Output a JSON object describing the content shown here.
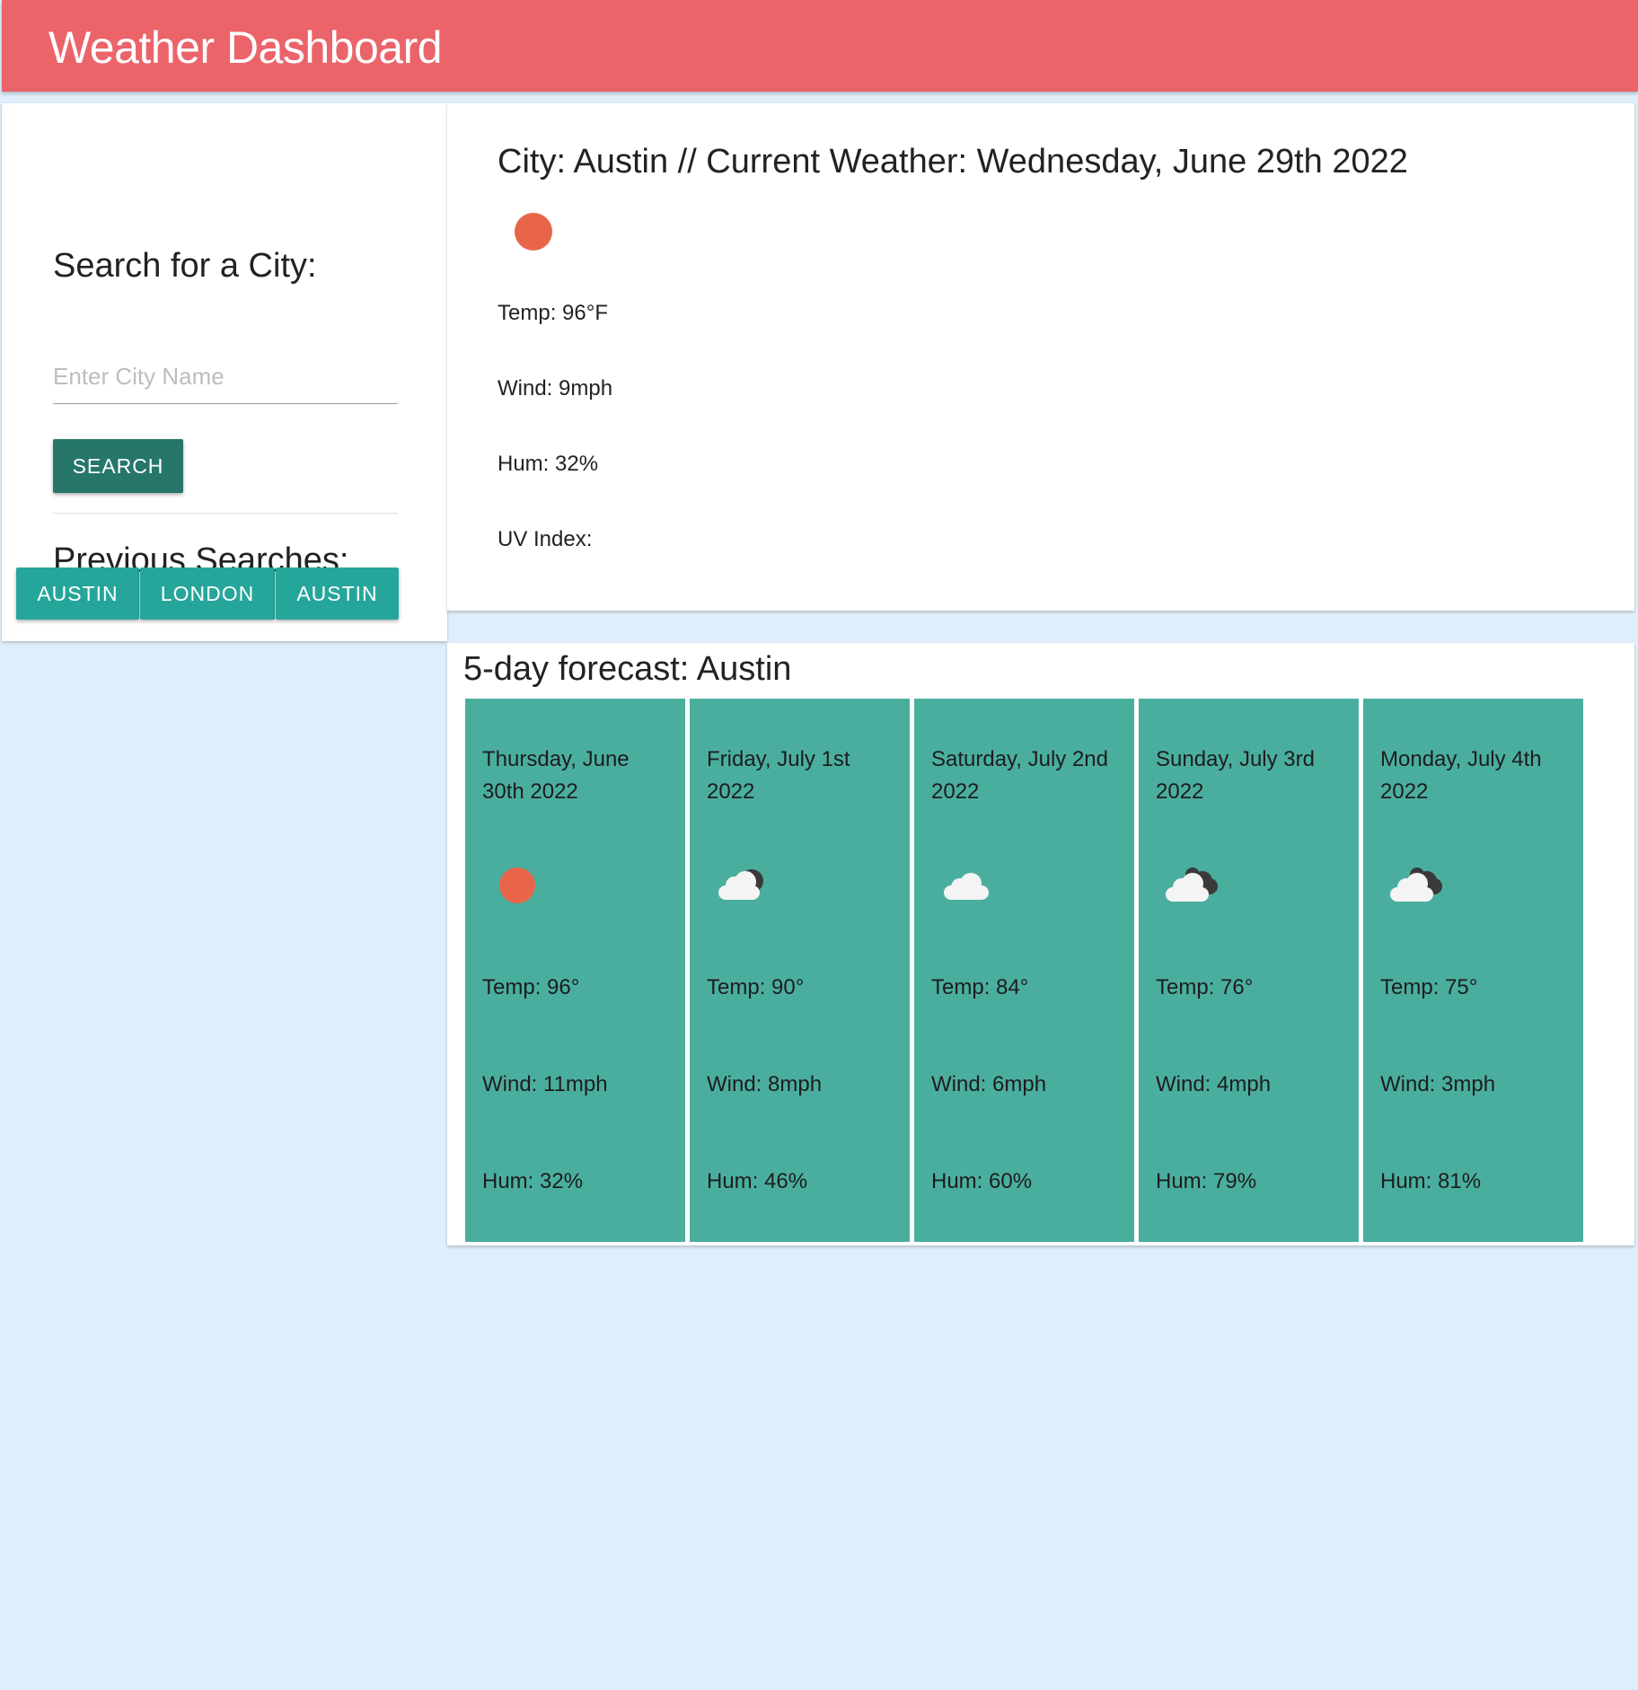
{
  "header": {
    "title": "Weather Dashboard"
  },
  "search": {
    "heading": "Search for a City:",
    "placeholder": "Enter City Name",
    "value": "",
    "button_label": "SEARCH",
    "history_heading": "Previous Searches:",
    "history": [
      "AUSTIN",
      "LONDON",
      "AUSTIN"
    ]
  },
  "current": {
    "heading": "City: Austin // Current Weather: Wednesday, June 29th 2022",
    "icon": "sun-icon",
    "temp": "Temp: 96°F",
    "wind": "Wind: 9mph",
    "humidity": "Hum: 32%",
    "uv": "UV Index:"
  },
  "forecast": {
    "heading": "5-day forecast: Austin",
    "days": [
      {
        "date": "Thursday, June 30th 2022",
        "icon": "sun-icon",
        "temp": "Temp: 96°",
        "wind": "Wind: 11mph",
        "humidity": "Hum: 32%"
      },
      {
        "date": "Friday, July 1st 2022",
        "icon": "partly-cloudy-icon",
        "temp": "Temp: 90°",
        "wind": "Wind: 8mph",
        "humidity": "Hum: 46%"
      },
      {
        "date": "Saturday, July 2nd 2022",
        "icon": "cloud-icon",
        "temp": "Temp: 84°",
        "wind": "Wind: 6mph",
        "humidity": "Hum: 60%"
      },
      {
        "date": "Sunday, July 3rd 2022",
        "icon": "broken-clouds-icon",
        "temp": "Temp: 76°",
        "wind": "Wind: 4mph",
        "humidity": "Hum: 79%"
      },
      {
        "date": "Monday, July 4th 2022",
        "icon": "broken-clouds-icon",
        "temp": "Temp: 75°",
        "wind": "Wind: 3mph",
        "humidity": "Hum: 81%"
      }
    ]
  },
  "colors": {
    "header": "#ea646a",
    "background": "#dfeefb",
    "search_button": "#26766b",
    "history_button": "#26a69a",
    "forecast_card": "#4aae9f",
    "sun": "#e8654a"
  }
}
